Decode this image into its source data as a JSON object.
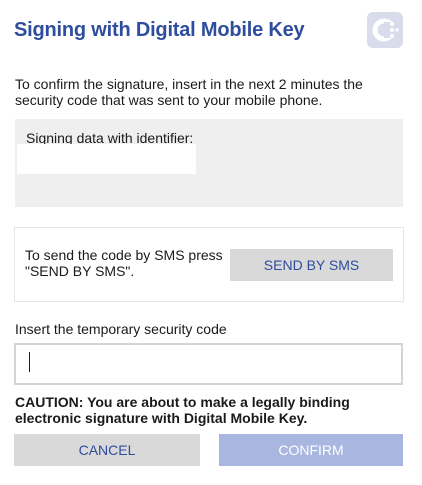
{
  "dialog": {
    "title": "Signing with Digital Mobile Key",
    "logo_icon": "digital-mobile-key-logo",
    "accent_color": "#2f4d9e",
    "intro_text": "To confirm the signature, insert in the next 2 minutes the security code that was sent to your mobile phone."
  },
  "signing_data": {
    "label": "Signing data with identifier:",
    "identifier": ""
  },
  "sms": {
    "instructions": "To send the code by SMS press \"SEND BY SMS\".",
    "button_label": "SEND BY SMS"
  },
  "code": {
    "label": "Insert the temporary security code",
    "value": ""
  },
  "caution": {
    "tag": "CAUTION:",
    "text": " You are about to make a legally binding electronic signature with Digital Mobile Key."
  },
  "actions": {
    "cancel_label": "CANCEL",
    "confirm_label": "CONFIRM"
  }
}
